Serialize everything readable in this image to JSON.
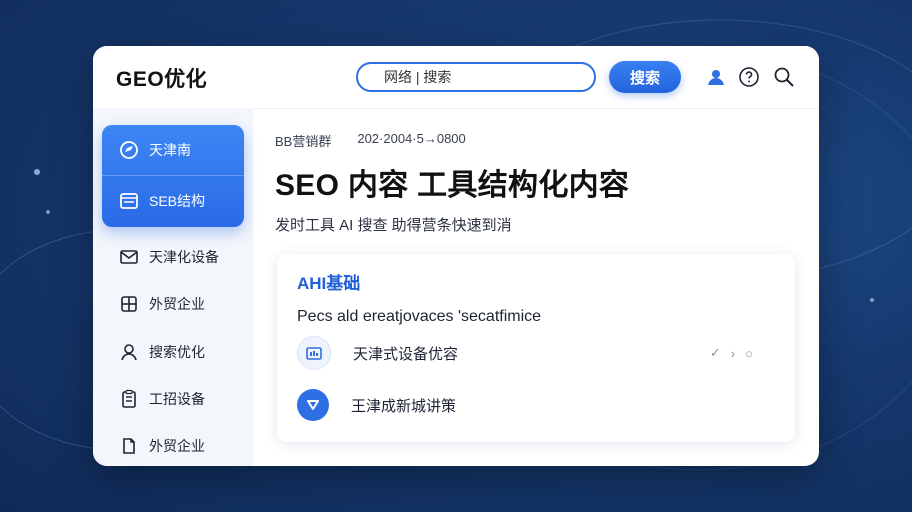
{
  "app": {
    "logo": "GEO优化"
  },
  "search": {
    "value": "网络 | 搜索",
    "button_label": "搜索"
  },
  "header_icons": [
    "user-icon",
    "help-icon",
    "search-icon"
  ],
  "sidebar": {
    "items": [
      {
        "label": "天津南",
        "icon": "compass-icon",
        "active": true
      },
      {
        "label": "SEB结构",
        "icon": "browser-icon",
        "active": true
      },
      {
        "label": "天津化设备",
        "icon": "mail-icon",
        "active": false
      },
      {
        "label": "外贸企业",
        "icon": "grid-icon",
        "active": false
      },
      {
        "label": "搜索优化",
        "icon": "user-icon",
        "active": false
      },
      {
        "label": "工招设备",
        "icon": "clipboard-icon",
        "active": false
      },
      {
        "label": "外贸企业",
        "icon": "document-icon",
        "active": false
      }
    ]
  },
  "main": {
    "meta_left": "BB营销群",
    "meta_date": "202·2004·5→0800",
    "title": "SEO 内容 工具结构化内容",
    "subtitle": "发时工具  AI 搜查  助得营条快速到消"
  },
  "card": {
    "title": "AHI基础",
    "description": "Pecs ald ereatjovaces 'secatfimice",
    "rows": [
      {
        "label": "天津式设备优容",
        "icon": "grid-icon"
      },
      {
        "label": "王津成新城讲策",
        "icon": "chevron-down-icon"
      }
    ],
    "row_actions": [
      "✓",
      "›",
      "○"
    ]
  },
  "colors": {
    "accent": "#2f6fe4",
    "background": "#16396f",
    "window": "#ffffff"
  }
}
